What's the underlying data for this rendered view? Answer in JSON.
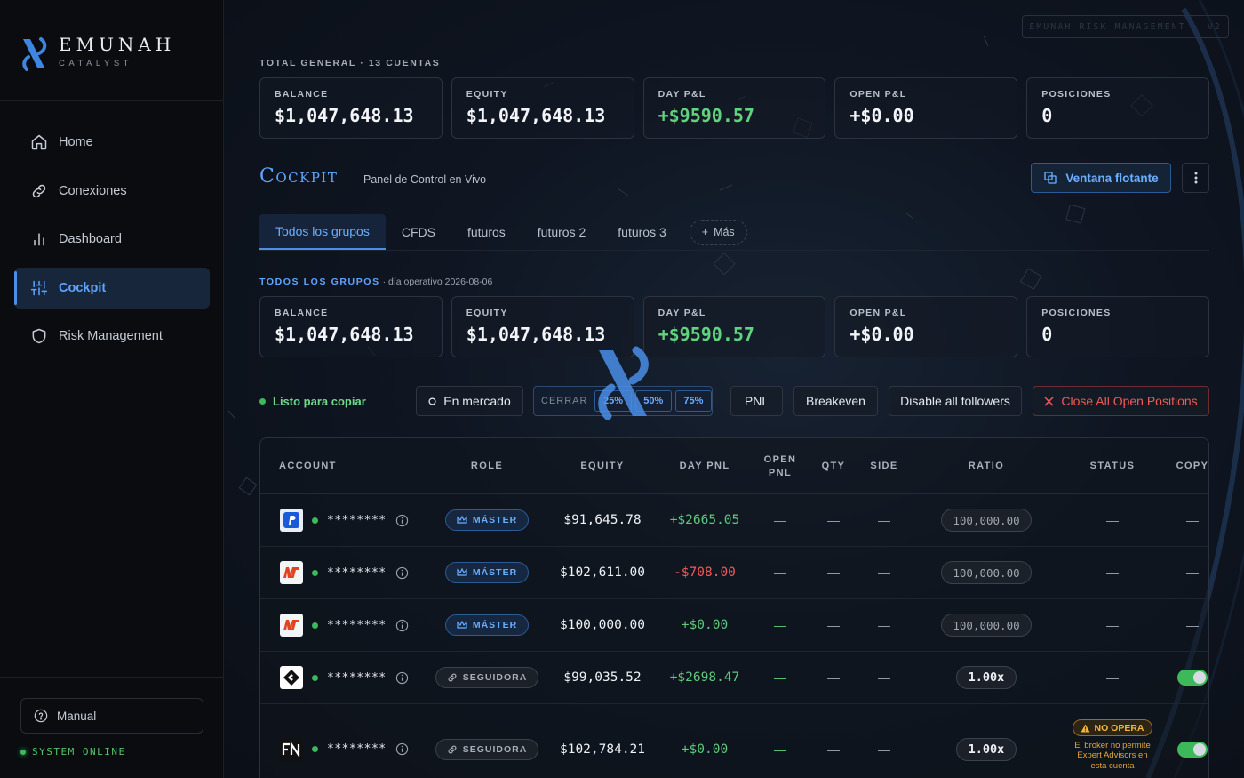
{
  "brand": {
    "name": "EMUNAH",
    "subtitle": "CATALYST"
  },
  "nav": [
    {
      "label": "Home",
      "icon": "home-icon"
    },
    {
      "label": "Conexiones",
      "icon": "link-icon"
    },
    {
      "label": "Dashboard",
      "icon": "bar-chart-icon"
    },
    {
      "label": "Cockpit",
      "icon": "sliders-icon",
      "active": true
    },
    {
      "label": "Risk Management",
      "icon": "shield-icon"
    }
  ],
  "manual": {
    "label": "Manual",
    "icon": "help-circle-icon"
  },
  "system_status": "SYSTEM ONLINE",
  "risk_tag": "EMUNAH RISK MANAGEMENT · V2",
  "total": {
    "label": "TOTAL GENERAL · 13 CUENTAS",
    "stats": [
      {
        "label": "BALANCE",
        "value": "$1,047,648.13"
      },
      {
        "label": "EQUITY",
        "value": "$1,047,648.13"
      },
      {
        "label": "DAY P&L",
        "value": "+$9590.57",
        "positive": true
      },
      {
        "label": "OPEN P&L",
        "value": "+$0.00"
      },
      {
        "label": "POSICIONES",
        "value": "0"
      }
    ]
  },
  "cockpit": {
    "title": "Cockpit",
    "subtitle": "Panel de Control en Vivo",
    "float_button": "Ventana flotante",
    "menu_icon": "more-vertical-icon"
  },
  "tabs": [
    "Todos los grupos",
    "CFDS",
    "futuros",
    "futuros 2",
    "futuros 3"
  ],
  "tab_more": "Más",
  "group": {
    "name": "TODOS LOS GRUPOS",
    "date_text": "· día operativo 2026-08-06",
    "stats": [
      {
        "label": "BALANCE",
        "value": "$1,047,648.13"
      },
      {
        "label": "EQUITY",
        "value": "$1,047,648.13"
      },
      {
        "label": "DAY P&L",
        "value": "+$9590.57",
        "positive": true
      },
      {
        "label": "OPEN P&L",
        "value": "+$0.00"
      },
      {
        "label": "POSICIONES",
        "value": "0"
      }
    ]
  },
  "actions": {
    "ready": "Listo para copiar",
    "market": "En mercado",
    "cerrar": "CERRAR",
    "percents": [
      "25%",
      "50%",
      "75%"
    ],
    "pnl": "PNL",
    "breakeven": "Breakeven",
    "disable": "Disable all followers",
    "close_all": "Close All Open Positions"
  },
  "table": {
    "headers": [
      "ACCOUNT",
      "ROLE",
      "EQUITY",
      "DAY PNL",
      "OPEN PNL",
      "QTY",
      "SIDE",
      "RATIO",
      "STATUS",
      "COPY"
    ],
    "rows": [
      {
        "logo": "paypal-logo",
        "account": "********",
        "role": "MÁSTER",
        "role_type": "master",
        "equity": "$91,645.78",
        "day_pnl": "+$2665.05",
        "pnl_sign": "pos",
        "open_pnl": "—",
        "qty": "—",
        "side": "—",
        "ratio": "100,000.00",
        "ratio_type": "value",
        "status": "—",
        "copy": "—"
      },
      {
        "logo": "nt-logo",
        "account": "********",
        "role": "MÁSTER",
        "role_type": "master",
        "equity": "$102,611.00",
        "day_pnl": "-$708.00",
        "pnl_sign": "neg",
        "open_pnl": "—",
        "qty": "—",
        "side": "—",
        "ratio": "100,000.00",
        "ratio_type": "value",
        "status": "—",
        "copy": "—"
      },
      {
        "logo": "nt-logo",
        "account": "********",
        "role": "MÁSTER",
        "role_type": "master",
        "equity": "$100,000.00",
        "day_pnl": "+$0.00",
        "pnl_sign": "pos",
        "open_pnl": "—",
        "qty": "—",
        "side": "—",
        "ratio": "100,000.00",
        "ratio_type": "value",
        "status": "—",
        "copy": "—"
      },
      {
        "logo": "diamond-logo",
        "account": "********",
        "role": "SEGUIDORA",
        "role_type": "follower",
        "equity": "$99,035.52",
        "day_pnl": "+$2698.47",
        "pnl_sign": "pos",
        "open_pnl": "—",
        "qty": "—",
        "side": "—",
        "ratio": "1.00x",
        "ratio_type": "mult",
        "status": "—",
        "copy": "toggle-on"
      },
      {
        "logo": "fn-logo",
        "account": "********",
        "role": "SEGUIDORA",
        "role_type": "follower",
        "equity": "$102,784.21",
        "day_pnl": "+$0.00",
        "pnl_sign": "pos",
        "open_pnl": "—",
        "qty": "—",
        "side": "—",
        "ratio": "1.00x",
        "ratio_type": "mult",
        "status": "NO OPERA",
        "status_note": "El broker no permite Expert Advisors en esta cuenta",
        "copy": "toggle-on"
      }
    ]
  },
  "colors": {
    "accent": "#5fa5ff",
    "positive": "#5ec97b",
    "negative": "#ef5a5a",
    "warning": "#f2b53c",
    "background": "#0b0f16"
  }
}
